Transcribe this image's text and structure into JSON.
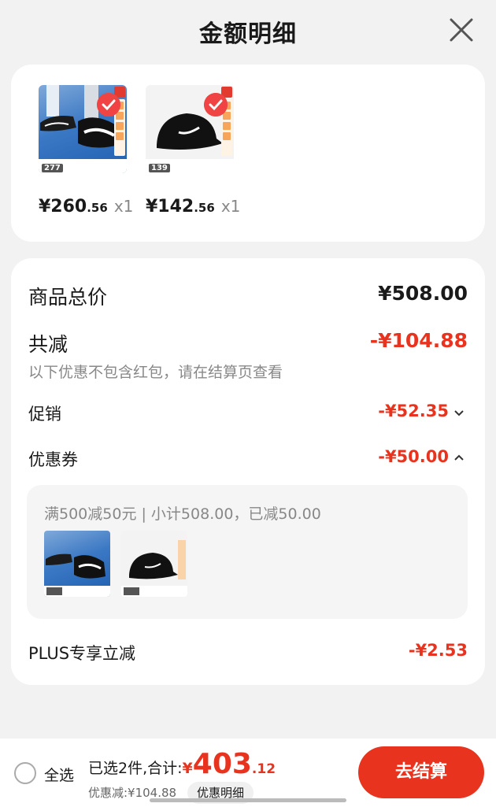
{
  "header": {
    "title": "金额明细"
  },
  "products": [
    {
      "price_int": "¥260",
      "price_dec": ".56",
      "qty": "x1",
      "badge": "277"
    },
    {
      "price_int": "¥142",
      "price_dec": ".56",
      "qty": "x1",
      "badge": "139"
    }
  ],
  "detail": {
    "goods_total_label": "商品总价",
    "goods_total_value": "¥508.00",
    "discount_label": "共减",
    "discount_value": "-¥104.88",
    "discount_note": "以下优惠不包含红包，请在结算页查看",
    "promo_label": "促销",
    "promo_value": "-¥52.35",
    "coupon_label": "优惠券",
    "coupon_value": "-¥50.00",
    "coupon_detail": "满500减50元 | 小计508.00，已减50.00",
    "plus_label": "PLUS专享立减",
    "plus_value": "-¥2.53"
  },
  "bottom": {
    "select_all": "全选",
    "selected_text": "已选2件,合计:",
    "total_yen": "¥",
    "total_int": "403",
    "total_dec": ".12",
    "discount_text": "优惠减:¥104.88",
    "detail_button": "优惠明细",
    "pay_button": "去结算"
  },
  "colors": {
    "accent": "#e8331f",
    "background": "#f2f2f2"
  }
}
